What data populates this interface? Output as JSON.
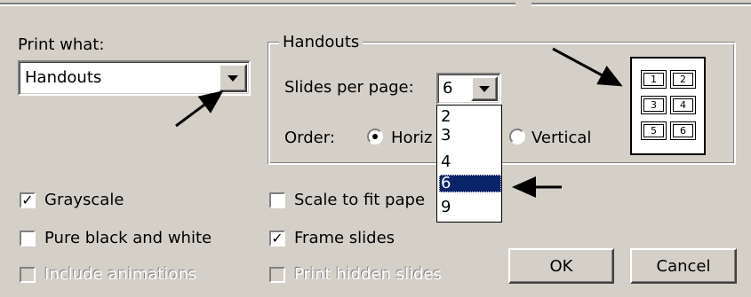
{
  "print_what": {
    "label": "Print what:",
    "value": "Handouts"
  },
  "handouts": {
    "group_label": "Handouts",
    "slides_per_page_label": "Slides per page:",
    "slides_per_page_value": "6",
    "slides_per_page_options": [
      "2",
      "3",
      "4",
      "6",
      "9"
    ],
    "selected_option": "6",
    "order_label": "Order:",
    "order_horizontal": "Horiz",
    "order_vertical": "Vertical",
    "preview_numbers": [
      "1",
      "2",
      "3",
      "4",
      "5",
      "6"
    ]
  },
  "options": {
    "grayscale": "Grayscale",
    "pure_black_white": "Pure black and white",
    "include_animations": "Include animations",
    "scale_to_fit": "Scale to fit pape",
    "frame_slides": "Frame slides",
    "print_hidden": "Print hidden slides"
  },
  "buttons": {
    "ok": "OK",
    "cancel": "Cancel"
  },
  "state": {
    "grayscale": true,
    "pure_black_white": false,
    "include_animations": false,
    "scale_to_fit": false,
    "frame_slides": true,
    "print_hidden": false,
    "order": "horizontal"
  },
  "icons": {
    "dropdown": "chevron-down-icon",
    "check": "check-icon",
    "arrow": "arrow-annotation-icon"
  }
}
